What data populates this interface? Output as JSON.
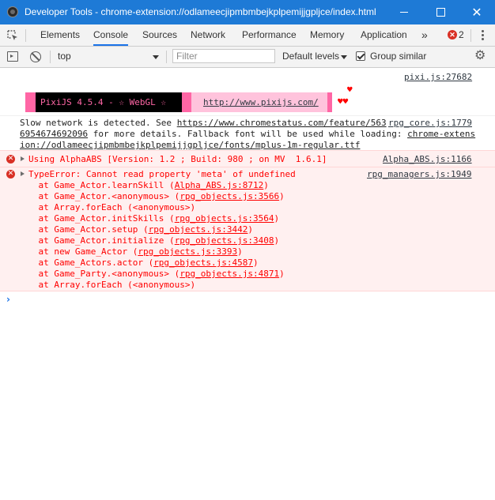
{
  "window": {
    "title": "Developer Tools - chrome-extension://odlameecjipmbmbejkplpemijjgpljce/index.html",
    "minimize_label": "–",
    "close_label": "✕"
  },
  "tabs": [
    {
      "label": "Elements"
    },
    {
      "label": "Console"
    },
    {
      "label": "Sources"
    },
    {
      "label": "Network"
    },
    {
      "label": "Performance"
    },
    {
      "label": "Memory"
    },
    {
      "label": "Application"
    }
  ],
  "tabbar": {
    "more_label": "»",
    "error_badge": "✕",
    "error_count": "2"
  },
  "toolbar": {
    "context": "top",
    "filter_placeholder": "Filter",
    "levels": "Default levels",
    "group_similar": "Group similar",
    "group_similar_checked": true
  },
  "console": {
    "pixi_source": "pixi.js:27682",
    "pixi_banner": "PixiJS 4.5.4 - ☆ WebGL ☆",
    "pixi_url": "http://www.pixijs.com/",
    "pixi_heart_top": "♥",
    "pixi_hearts": "♥♥",
    "slow_network": {
      "line1_prefix": "Slow network is detected. See ",
      "line1_link": "https://www.chromestatus.com/feature/563",
      "line2_link": "6954674692096",
      "line2_mid": " for more details. Fallback font will be used while loading: ",
      "line2_link2": "chrome-extens",
      "line3_link": "ion://odlameecjipmbmbejkplpemijjgpljce/fonts/mplus-1m-regular.ttf",
      "source": "rpg_core.js:1779"
    },
    "alpha_abs": {
      "text": "Using AlphaABS [Version: 1.2 ; Build: 980 ; on MV  1.6.1]",
      "source": "Alpha_ABS.js:1166"
    },
    "type_error": {
      "text": "TypeError: Cannot read property 'meta' of undefined",
      "source": "rpg_managers.js:1949",
      "stack": [
        {
          "prefix": "    at Game_Actor.learnSkill (",
          "link": "Alpha_ABS.js:8712",
          "suffix": ")"
        },
        {
          "prefix": "    at Game_Actor.<anonymous> (",
          "link": "rpg_objects.js:3566",
          "suffix": ")"
        },
        {
          "prefix": "    at Array.forEach (<anonymous>)",
          "link": "",
          "suffix": ""
        },
        {
          "prefix": "    at Game_Actor.initSkills (",
          "link": "rpg_objects.js:3564",
          "suffix": ")"
        },
        {
          "prefix": "    at Game_Actor.setup (",
          "link": "rpg_objects.js:3442",
          "suffix": ")"
        },
        {
          "prefix": "    at Game_Actor.initialize (",
          "link": "rpg_objects.js:3408",
          "suffix": ")"
        },
        {
          "prefix": "    at new Game_Actor (",
          "link": "rpg_objects.js:3393",
          "suffix": ")"
        },
        {
          "prefix": "    at Game_Actors.actor (",
          "link": "rpg_objects.js:4587",
          "suffix": ")"
        },
        {
          "prefix": "    at Game_Party.<anonymous> (",
          "link": "rpg_objects.js:4871",
          "suffix": ")"
        },
        {
          "prefix": "    at Array.forEach (<anonymous>)",
          "link": "",
          "suffix": ""
        }
      ]
    },
    "prompt": "›"
  },
  "colors": {
    "titlebar": "#1e7ad6",
    "error_text": "#ff0000",
    "error_bg": "#fff0f0",
    "pixi_pink": "#ff66a5",
    "active_tab": "#1a73e8"
  }
}
